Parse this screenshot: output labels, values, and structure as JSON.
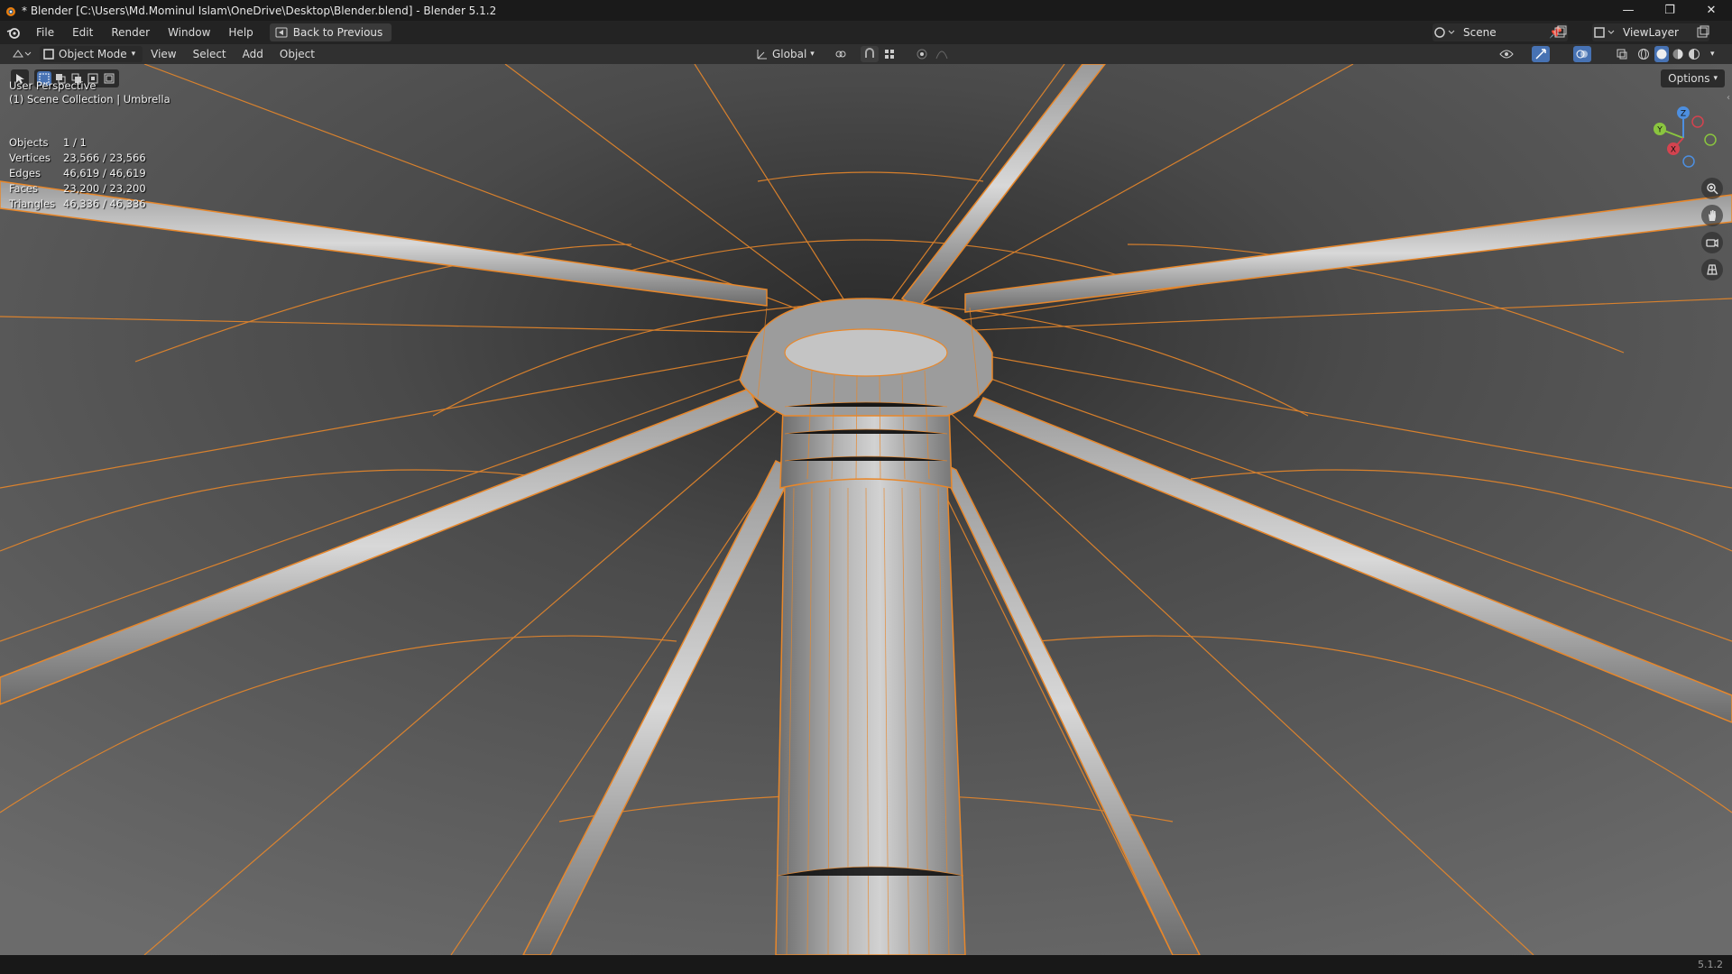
{
  "window": {
    "title": "* Blender [C:\\Users\\Md.Mominul Islam\\OneDrive\\Desktop\\Blender.blend] - Blender 5.1.2",
    "minimize": "—",
    "maximize": "❐",
    "close": "✕"
  },
  "menubar": {
    "items": [
      "File",
      "Edit",
      "Render",
      "Window",
      "Help"
    ],
    "back_button": "Back to Previous",
    "scene_name": "Scene",
    "view_layer": "ViewLayer"
  },
  "header3d": {
    "mode": "Object Mode",
    "menus": [
      "View",
      "Select",
      "Add",
      "Object"
    ],
    "orientation": "Global"
  },
  "viewport": {
    "perspective": "User Perspective",
    "collection": "(1) Scene Collection | Umbrella",
    "options": "Options",
    "stats": [
      {
        "label": "Objects",
        "value": "1 / 1"
      },
      {
        "label": "Vertices",
        "value": "23,566 / 23,566"
      },
      {
        "label": "Edges",
        "value": "46,619 / 46,619"
      },
      {
        "label": "Faces",
        "value": "23,200 / 23,200"
      },
      {
        "label": "Triangles",
        "value": "46,336 / 46,336"
      }
    ],
    "gizmo": {
      "x": "X",
      "y": "Y",
      "z": "Z"
    },
    "colors": {
      "wire": "#e8872a",
      "background": "#3d3d3d",
      "x_axis": "#d4434f",
      "y_axis": "#8ac53f",
      "z_axis": "#4d8fe0"
    }
  },
  "statusbar": {
    "version": "5.1.2"
  }
}
